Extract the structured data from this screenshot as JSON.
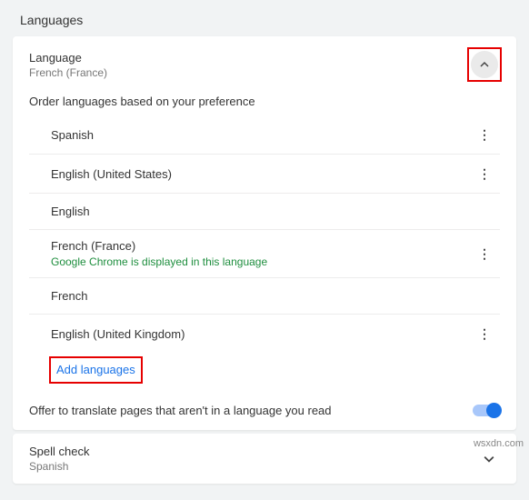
{
  "page": {
    "title": "Languages"
  },
  "language_section": {
    "title": "Language",
    "current": "French (France)",
    "instruction": "Order languages based on your preference",
    "items": [
      {
        "name": "Spanish",
        "note": ""
      },
      {
        "name": "English (United States)",
        "note": ""
      },
      {
        "name": "English",
        "note": ""
      },
      {
        "name": "French (France)",
        "note": "Google Chrome is displayed in this language"
      },
      {
        "name": "French",
        "note": ""
      },
      {
        "name": "English (United Kingdom)",
        "note": ""
      }
    ],
    "add_label": "Add languages"
  },
  "translate": {
    "label": "Offer to translate pages that aren't in a language you read",
    "enabled": true
  },
  "spellcheck": {
    "title": "Spell check",
    "value": "Spanish"
  },
  "watermark": "wsxdn.com"
}
